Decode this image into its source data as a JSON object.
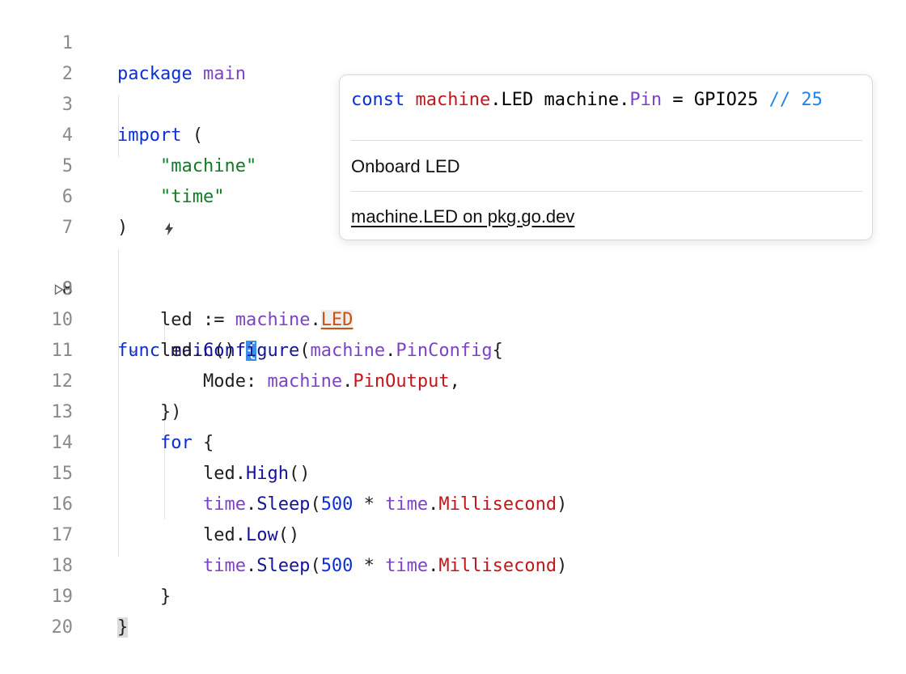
{
  "editor": {
    "line_numbers": [
      "1",
      "2",
      "3",
      "4",
      "5",
      "6",
      "7",
      "8",
      "9",
      "10",
      "11",
      "12",
      "13",
      "14",
      "15",
      "16",
      "17",
      "18",
      "19",
      "20"
    ],
    "run_gutter_icon": "play-triangle-icon",
    "fold_icon": "chevron-down-icon",
    "inlay_hint_icon": "lightning-icon",
    "tokens": {
      "package_kw": "package",
      "main_pkg": "main",
      "import_kw": "import",
      "open_paren": "(",
      "close_paren": ")",
      "import_machine": "\"machine\"",
      "import_time": "\"time\"",
      "func_kw": "func",
      "main_fn": "main",
      "parens": "()",
      "open_brace": "{",
      "close_brace": "}",
      "led_var": "led",
      "assign_op": " := ",
      "machine_pkg": "machine",
      "dot": ".",
      "LED_const": "LED",
      "configure_fn": "Configure",
      "pinconfig_type": "PinConfig",
      "mode_field": "Mode: ",
      "pinoutput_const": "PinOutput",
      "comma": ",",
      "close_brace_paren": "})",
      "for_kw": "for",
      "high_fn": "High",
      "low_fn": "Low",
      "time_pkg": "time",
      "sleep_fn": "Sleep",
      "num_500": "500",
      "star_op": " * ",
      "millisecond_const": "Millisecond"
    }
  },
  "popup": {
    "signature": {
      "const_kw": "const",
      "machine_pkg_red": "machine",
      "dot": ".",
      "led_name": "LED",
      "machine_pkg_type": "machine",
      "pin_type": "Pin",
      "equals": " = ",
      "gpio": "GPIO25",
      "comment": "// 25"
    },
    "doc": "Onboard LED",
    "link_text": "machine.LED on pkg.go.dev"
  },
  "colors": {
    "keyword": "#0b2fd6",
    "package": "#7d43c6",
    "string": "#117a26",
    "function": "#14139a",
    "constant": "#c1171a",
    "comment": "#1f84e8",
    "brace_highlight": "#3d8fe6"
  }
}
